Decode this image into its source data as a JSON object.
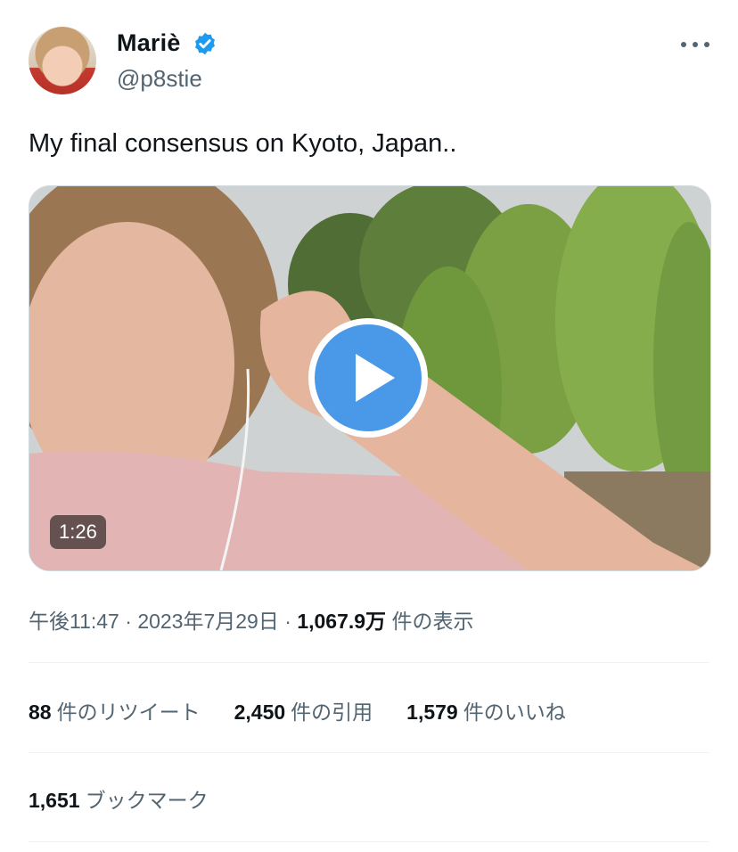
{
  "author": {
    "name": "Mariè",
    "handle": "@p8stie",
    "verified_icon": "verified-badge-icon",
    "accent_color": "#1d9bf0"
  },
  "tweet": {
    "text": "My final consensus on Kyoto, Japan.."
  },
  "media": {
    "duration": "1:26",
    "play_icon": "play-icon"
  },
  "meta": {
    "time": "午後11:47",
    "separator": " · ",
    "date": "2023年7月29日",
    "views_count": "1,067.9万",
    "views_label": " 件の表示"
  },
  "stats": {
    "retweets_count": "88",
    "retweets_label": "件のリツイート",
    "quotes_count": "2,450",
    "quotes_label": "件の引用",
    "likes_count": "1,579",
    "likes_label": "件のいいね",
    "bookmarks_count": "1,651",
    "bookmarks_label": "ブックマーク"
  }
}
